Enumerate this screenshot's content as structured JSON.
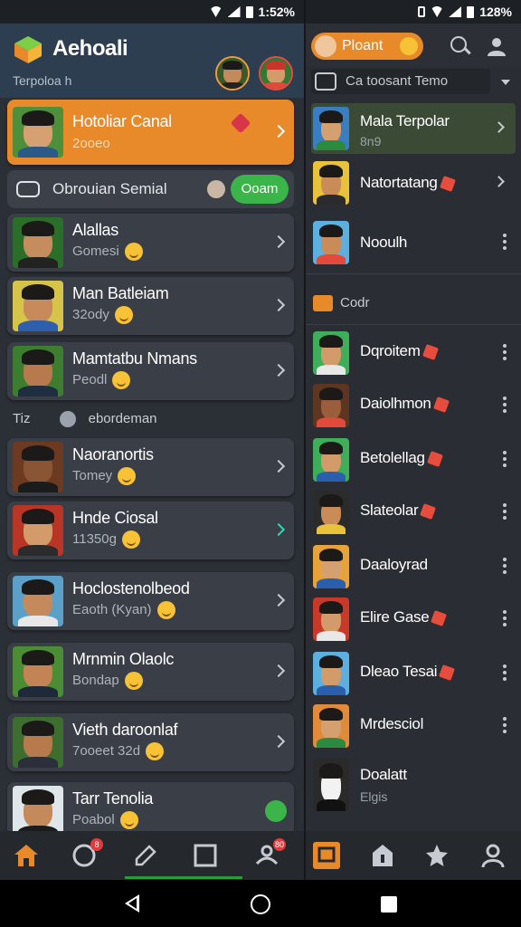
{
  "left": {
    "status": {
      "time": "1:52%"
    },
    "header": {
      "title": "Aehoali",
      "subtitle": "Terpoloa h"
    },
    "featured": {
      "name": "Hotoliar Canal",
      "sub": "2ooeo"
    },
    "search": {
      "label": "Obrouian Semial",
      "button": "Ooam"
    },
    "contacts": [
      {
        "name": "Alallas",
        "sub": "Gomesi",
        "bg": "#2b6e2a",
        "skin": "#c58c5e",
        "shirt": "#222"
      },
      {
        "name": "Man Batleiam",
        "sub": "32ody",
        "bg": "#d6c34a",
        "skin": "#c88a5a",
        "shirt": "#2e5fae"
      },
      {
        "name": "Mamtatbu Nmans",
        "sub": "Peodl",
        "bg": "#3c7d2f",
        "skin": "#b67a4e",
        "shirt": "#1f2d40"
      }
    ],
    "section": {
      "label": "Tiz",
      "sublabel": "ebordeman"
    },
    "contacts2": [
      {
        "name": "Naoranortis",
        "sub": "Tomey",
        "bg": "#6b3a20",
        "skin": "#8a5535",
        "shirt": "#1b1b1b"
      },
      {
        "name": "Hnde Ciosal",
        "sub": "11350g",
        "bg": "#b93525",
        "skin": "#d39a6a",
        "shirt": "#2b2b2b",
        "teal": true
      },
      {
        "name": "Hoclostenolbeod",
        "sub": "Eaoth (Kyan)",
        "bg": "#5aa0c8",
        "skin": "#c48a5c",
        "shirt": "#e8e8e8"
      },
      {
        "name": "Mrnmin Olaolc",
        "sub": "Bondap",
        "bg": "#4a8d35",
        "skin": "#c38355",
        "shirt": "#1e2a3a"
      },
      {
        "name": "Vieth daroonlaf",
        "sub": "7ooeet 32d",
        "bg": "#3d6e30",
        "skin": "#b77a4c",
        "shirt": "#2a2f3a"
      },
      {
        "name": "Tarr Tenolia",
        "sub": "Poabol",
        "bg": "#dfe6ea",
        "skin": "#c48a5c",
        "shirt": "#1c1c1c"
      }
    ],
    "tabs": {
      "badge1": "8",
      "badge2": "80"
    }
  },
  "right": {
    "status": {
      "time": "128%"
    },
    "header": {
      "pill_label": "Ploant"
    },
    "dropdown": {
      "label": "Ca toosant Temo"
    },
    "top_items": [
      {
        "name": "Mala Terpolar",
        "sub": "8n9",
        "bg": "#3a7dc0",
        "skin": "#d5a070",
        "shirt": "#2b8a3e",
        "hl": true
      },
      {
        "name": "Natortatang",
        "sub": "",
        "bg": "#e7c23a",
        "skin": "#c98b58",
        "shirt": "#2b2b2b"
      },
      {
        "name": "Nooulh",
        "sub": "",
        "bg": "#5cb0e0",
        "skin": "#c98b58",
        "shirt": "#e24a3b"
      }
    ],
    "section": {
      "label": "Codr"
    },
    "items": [
      {
        "name": "Dqroitem",
        "bg": "#3fae5a",
        "skin": "#d39a6a",
        "shirt": "#e8e8e8"
      },
      {
        "name": "Daiolhmon",
        "bg": "#5e3520",
        "skin": "#9a5e3c",
        "shirt": "#e04a3a"
      },
      {
        "name": "Betolellag",
        "bg": "#3fae5a",
        "skin": "#d39a6a",
        "shirt": "#2a5fae"
      },
      {
        "name": "Slateolar",
        "bg": "#2b2b2b",
        "skin": "#c98b58",
        "shirt": "#e7c23a"
      },
      {
        "name": "Daaloyrad",
        "bg": "#e7a23a",
        "skin": "#d5a070",
        "shirt": "#2a5fae"
      },
      {
        "name": "Elire Gase",
        "bg": "#c9392a",
        "skin": "#d39a6a",
        "shirt": "#e8e8e8"
      },
      {
        "name": "Dleao Tesai",
        "bg": "#5cb0e0",
        "skin": "#d39a6a",
        "shirt": "#2a5fae"
      },
      {
        "name": "Mrdesciol",
        "bg": "#e08a3a",
        "skin": "#d5a070",
        "shirt": "#2b8a3e"
      },
      {
        "name": "Doalatt",
        "sub": "Elgis",
        "bg": "#2a2a2a",
        "skin": "#f2f2f2",
        "shirt": "#111"
      }
    ]
  }
}
